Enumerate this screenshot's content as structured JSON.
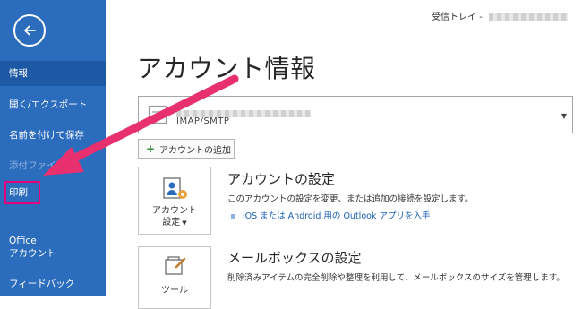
{
  "sidebar": {
    "items": [
      {
        "id": "info",
        "label": "情報"
      },
      {
        "id": "open-export",
        "label": "開く/エクスポート"
      },
      {
        "id": "save-as",
        "label": "名前を付けて保存"
      },
      {
        "id": "attachments",
        "label": "添付ファイル"
      },
      {
        "id": "print",
        "label": "印刷"
      },
      {
        "id": "office-account-line1",
        "label": "Office"
      },
      {
        "id": "office-account-line2",
        "label": "アカウント"
      },
      {
        "id": "feedback",
        "label": "フィードバック"
      }
    ]
  },
  "header": {
    "folder": "受信トレイ -"
  },
  "main": {
    "title": "アカウント情報",
    "account": {
      "type": "IMAP/SMTP"
    },
    "add_account_label": "アカウントの追加",
    "account_settings": {
      "title": "アカウントの設定",
      "tile_label_line1": "アカウント",
      "tile_label_line2": "設定",
      "description": "このアカウントの設定を変更、または追加の接続を設定します。",
      "link": "iOS または Android 用の Outlook アプリを入手"
    },
    "mailbox_settings": {
      "title": "メールボックスの設定",
      "tile_label": "ツール",
      "description": "削除済みアイテムの完全削除や整理を利用して、メールボックスのサイズを管理します。"
    }
  },
  "colors": {
    "sidebar": "#2b6cbd",
    "sidebar_selected": "#1c58a4",
    "highlight": "#e4007f",
    "arrow": "#e8306e"
  }
}
